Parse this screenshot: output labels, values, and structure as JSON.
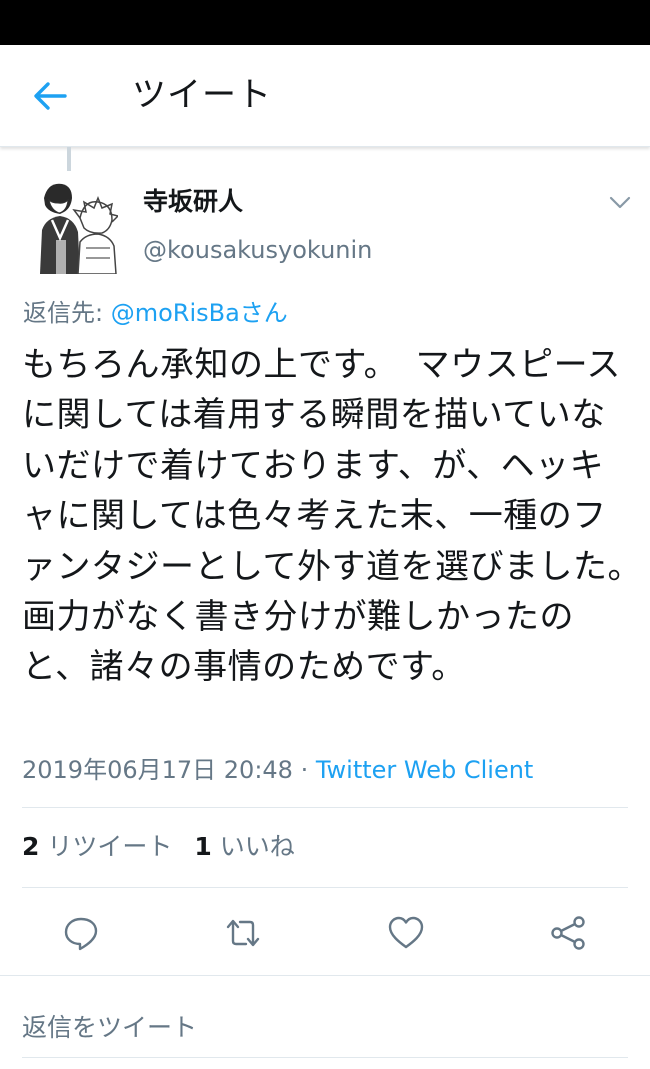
{
  "header": {
    "title": "ツイート",
    "back_icon": "arrow-left-icon"
  },
  "tweet": {
    "display_name": "寺坂研人",
    "handle": "@kousakusyokunin",
    "reply_prefix": "返信先: ",
    "reply_mention": "@moRisBaさん",
    "text": "もちろん承知の上です。　マウスピースに関しては着用する瞬間を描いていないだけで着けております、が、ヘッキャに関しては色々考えた末、一種のファンタジーとして外す道を選びました。　画力がなく書き分けが難しかったのと、諸々の事情のためです。",
    "timestamp": "2019年06月17日 20:48",
    "separator": " · ",
    "client": "Twitter Web Client"
  },
  "stats": {
    "retweets_count": "2",
    "retweets_label": " リツイート",
    "likes_count": "1",
    "likes_label": " いいね"
  },
  "actions": [
    "reply-icon",
    "retweet-icon",
    "like-icon",
    "share-icon"
  ],
  "reply_box": {
    "placeholder": "返信をツイート"
  },
  "colors": {
    "accent": "#1da1f2",
    "secondary_text": "#657786",
    "primary_text": "#14171a",
    "divider": "#e1e8ed"
  }
}
